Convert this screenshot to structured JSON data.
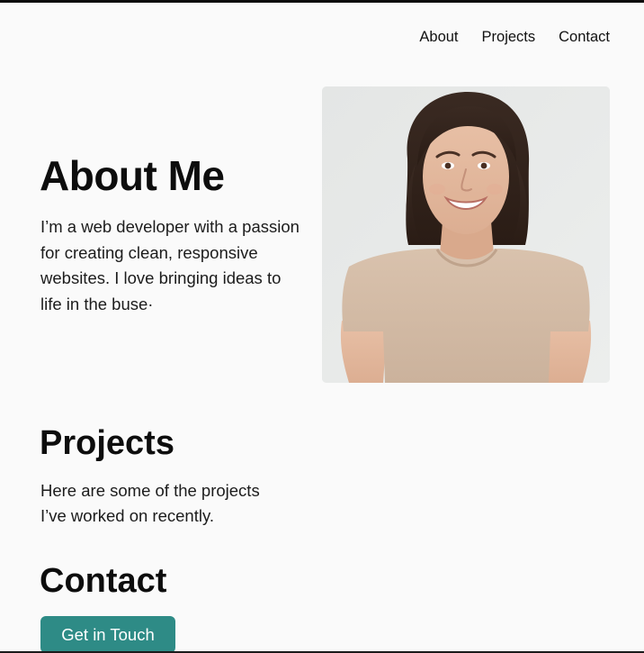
{
  "nav": {
    "items": [
      {
        "label": "About"
      },
      {
        "label": "Projects"
      },
      {
        "label": "Contact"
      }
    ]
  },
  "about": {
    "title": "About Me",
    "text": "I’m a web developer with a passion for creating clean, responsive websites. I love bringing ideas to life in the buse·"
  },
  "projects": {
    "title": "Projects",
    "text": "Here are some of the projects I’ve worked on recently."
  },
  "contact": {
    "title": "Contact",
    "button_label": "Get in Touch"
  },
  "colors": {
    "background": "#fafafa",
    "accent_button": "#2e8b86",
    "text": "#111111"
  },
  "icons": {
    "portrait": "profile-photo"
  }
}
